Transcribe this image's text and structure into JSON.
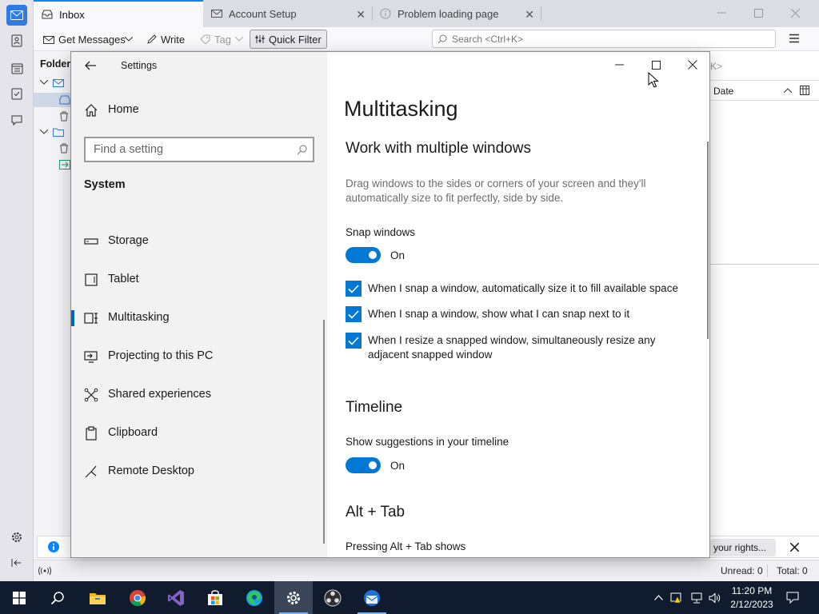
{
  "thunderbird": {
    "tabs": [
      {
        "label": "Inbox",
        "active": true
      },
      {
        "label": "Account Setup",
        "active": false
      },
      {
        "label": "Problem loading page",
        "active": false
      }
    ],
    "toolbar": {
      "get_messages": "Get Messages",
      "write": "Write",
      "tag": "Tag",
      "quick_filter": "Quick Filter",
      "search_placeholder": "Search <Ctrl+K>"
    },
    "folder_pane_title": "Folders",
    "column_date": "Date",
    "filter_placeholder_tail": "K>",
    "notification_button": "your rights...",
    "status": {
      "unread": "Unread: 0",
      "total": "Total: 0"
    }
  },
  "settings": {
    "window_title": "Settings",
    "nav": {
      "home": "Home",
      "search_placeholder": "Find a setting",
      "section": "System",
      "items": [
        {
          "label": "Storage",
          "icon": "storage-icon"
        },
        {
          "label": "Tablet",
          "icon": "tablet-icon"
        },
        {
          "label": "Multitasking",
          "icon": "multitasking-icon",
          "selected": true
        },
        {
          "label": "Projecting to this PC",
          "icon": "projecting-icon"
        },
        {
          "label": "Shared experiences",
          "icon": "shared-experiences-icon"
        },
        {
          "label": "Clipboard",
          "icon": "clipboard-icon"
        },
        {
          "label": "Remote Desktop",
          "icon": "remote-desktop-icon"
        }
      ]
    },
    "content": {
      "page_title": "Multitasking",
      "section1_title": "Work with multiple windows",
      "section1_desc": "Drag windows to the sides or corners of your screen and they'll automatically size to fit perfectly, side by side.",
      "snap_label": "Snap windows",
      "snap_state": "On",
      "checkboxes": [
        "When I snap a window, automatically size it to fill available space",
        "When I snap a window, show what I can snap next to it",
        "When I resize a snapped window, simultaneously resize any adjacent snapped window"
      ],
      "timeline_title": "Timeline",
      "timeline_label": "Show suggestions in your timeline",
      "timeline_state": "On",
      "alttab_title": "Alt + Tab",
      "alttab_label": "Pressing Alt + Tab shows"
    }
  },
  "taskbar": {
    "time": "11:20 PM",
    "date": "2/12/2023"
  },
  "colors": {
    "accent": "#0078d4",
    "taskbar": "#101b2e",
    "thunderbird_accent": "#0a84ff"
  }
}
